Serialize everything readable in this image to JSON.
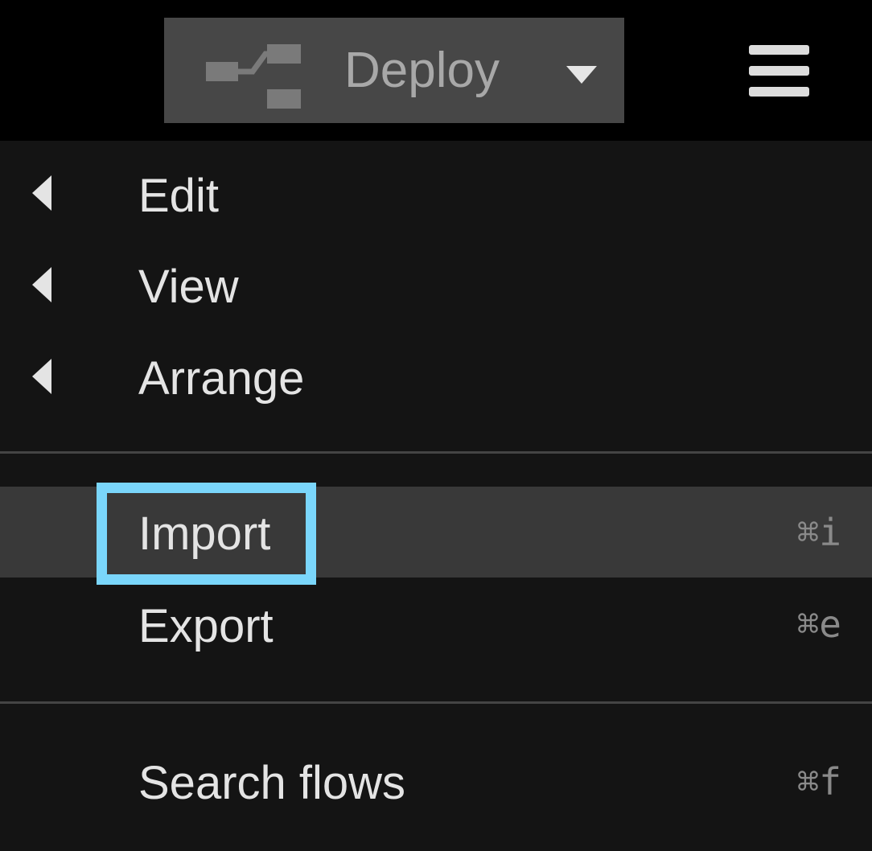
{
  "toolbar": {
    "deploy_label": "Deploy",
    "deploy_icon": "deploy-flow-icon",
    "dropdown_icon": "caret-down-icon",
    "menu_icon": "hamburger-menu-icon"
  },
  "menu": {
    "submenus": [
      {
        "label": "Edit",
        "icon": "chevron-left-icon"
      },
      {
        "label": "View",
        "icon": "chevron-left-icon"
      },
      {
        "label": "Arrange",
        "icon": "chevron-left-icon"
      }
    ],
    "actions": [
      {
        "label": "Import",
        "shortcut": "⌘i",
        "highlighted": true
      },
      {
        "label": "Export",
        "shortcut": "⌘e",
        "highlighted": false
      }
    ],
    "search": {
      "label": "Search flows",
      "shortcut": "⌘f"
    }
  },
  "colors": {
    "topbar_bg": "#000000",
    "menu_bg": "#141414",
    "hover_row_bg": "#393939",
    "deploy_bg": "#474747",
    "highlight_border": "#7ad6fb",
    "text": "#e4e4e4",
    "shortcut_text": "#8a8a8a"
  }
}
